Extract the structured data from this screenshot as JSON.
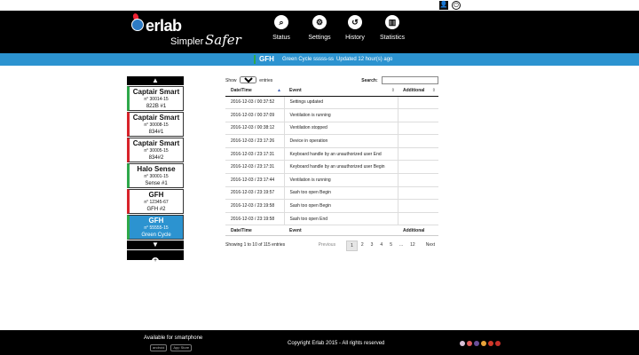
{
  "window": {
    "title": ""
  },
  "topbar": {
    "user_icon": "user-icon",
    "power_icon": "power-icon"
  },
  "logo": {
    "brand": "erlab",
    "simpler": "Simpler",
    "safer": "Safer"
  },
  "nav": [
    {
      "label": "Status",
      "icon": "search-icon",
      "glyph": "⌕"
    },
    {
      "label": "Settings",
      "icon": "gear-icon",
      "glyph": "⚙"
    },
    {
      "label": "History",
      "icon": "history-icon",
      "glyph": "↺"
    },
    {
      "label": "Statistics",
      "icon": "bar-chart-icon",
      "glyph": "▥"
    }
  ],
  "statusbar": {
    "device": "GFH",
    "cycle": "Green Cycle sssss-ss",
    "updated": "Updated 12 hour(s) ago"
  },
  "devices": [
    {
      "name": "Captair Smart",
      "serial": "n° 30014-15",
      "label": "822B #1",
      "status": "green"
    },
    {
      "name": "Captair Smart",
      "serial": "n° 30008-15",
      "label": "834#1",
      "status": "red"
    },
    {
      "name": "Captair Smart",
      "serial": "n° 30005-15",
      "label": "834#2",
      "status": "red"
    },
    {
      "name": "Halo Sense",
      "serial": "n° 30001-15",
      "label": "Sense #1",
      "status": "green"
    },
    {
      "name": "GFH",
      "serial": "n° 12345-67",
      "label": "GFH #2",
      "status": "red"
    },
    {
      "name": "GFH",
      "serial": "n° 55555-15",
      "label": "Green Cycle",
      "status": "active"
    }
  ],
  "devlist": {
    "up_glyph": "▲",
    "down_glyph": "▼",
    "add_glyph": "+"
  },
  "table": {
    "show_label": "Show",
    "entries_label": "entries",
    "page_size": "10",
    "search_label": "Search:",
    "search_value": "",
    "columns": [
      "Date/Time",
      "Event",
      "Additional"
    ],
    "rows": [
      [
        "2016-12-03 / 00:37:52",
        "Settings updated",
        ""
      ],
      [
        "2016-12-03 / 00:37:09",
        "Ventilation is running",
        ""
      ],
      [
        "2016-12-03 / 00:38:12",
        "Ventilation stopped",
        ""
      ],
      [
        "2016-12-03 / 23:17:26",
        "Device in operation",
        ""
      ],
      [
        "2016-12-03 / 23:17:31",
        "Keyboard handle by an unauthorized user End",
        ""
      ],
      [
        "2016-12-03 / 23:17:31",
        "Keyboard handle by an unauthorized user Begin",
        ""
      ],
      [
        "2016-12-03 / 23:17:44",
        "Ventilation is running",
        ""
      ],
      [
        "2016-12-03 / 23:19:57",
        "Sash too open Begin",
        ""
      ],
      [
        "2016-12-03 / 23:19:58",
        "Sash too open Begin",
        ""
      ],
      [
        "2016-12-03 / 23:19:58",
        "Sash too open End",
        ""
      ]
    ],
    "info": "Showing 1 to 10 of 115 entries",
    "pager": {
      "prev": "Previous",
      "pages": [
        "1",
        "2",
        "3",
        "4",
        "5",
        "...",
        "12"
      ],
      "current": "1",
      "next": "Next"
    }
  },
  "footer": {
    "available": "Available for smartphone",
    "android": "android",
    "appstore": "App Store",
    "copyright": "Copyright Erlab 2015 - All rights reserved",
    "flag_colors": [
      "#d9c0d8",
      "#e05a5a",
      "#6a4f9a",
      "#e8a43a",
      "#d23a2a",
      "#c8302a"
    ]
  }
}
